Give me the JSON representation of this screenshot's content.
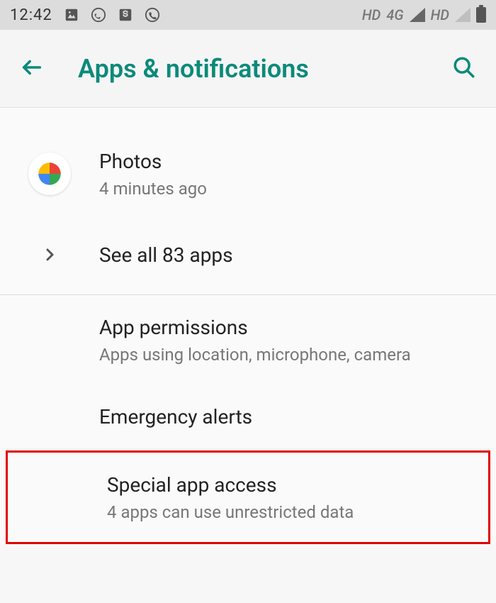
{
  "status_bar": {
    "time": "12:42",
    "network1_label": "HD",
    "network1_tech": "4G",
    "network2_label": "HD"
  },
  "app_bar": {
    "title": "Apps & notifications"
  },
  "recent": {
    "photos": {
      "title": "Photos",
      "subtitle": "4 minutes ago"
    },
    "see_all": "See all 83 apps"
  },
  "sections": {
    "permissions": {
      "title": "App permissions",
      "subtitle": "Apps using location, microphone, camera"
    },
    "emergency": {
      "title": "Emergency alerts"
    },
    "special_access": {
      "title": "Special app access",
      "subtitle": "4 apps can use unrestricted data"
    }
  }
}
